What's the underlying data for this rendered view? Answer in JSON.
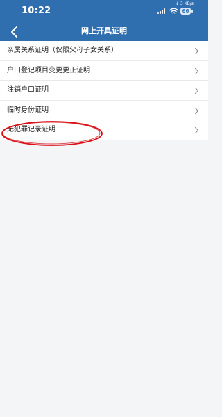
{
  "status_bar": {
    "time": "10:22",
    "network_speed": "↓ 3 KB/s",
    "battery": "66",
    "signal_icon": "signal-icon",
    "wifi_icon": "wifi-icon"
  },
  "nav": {
    "title": "网上开具证明",
    "back_icon": "chevron-left-icon"
  },
  "menu": {
    "items": [
      {
        "label": "亲属关系证明（仅限父母子女关系）"
      },
      {
        "label": "户口登记项目变更更正证明"
      },
      {
        "label": "注销户口证明"
      },
      {
        "label": "临时身份证明"
      },
      {
        "label": "无犯罪记录证明"
      }
    ],
    "chevron_icon": "chevron-right-icon"
  },
  "colors": {
    "header": "#2f6fb0",
    "background": "#f4f5f7",
    "annotation": "#d90f18"
  }
}
